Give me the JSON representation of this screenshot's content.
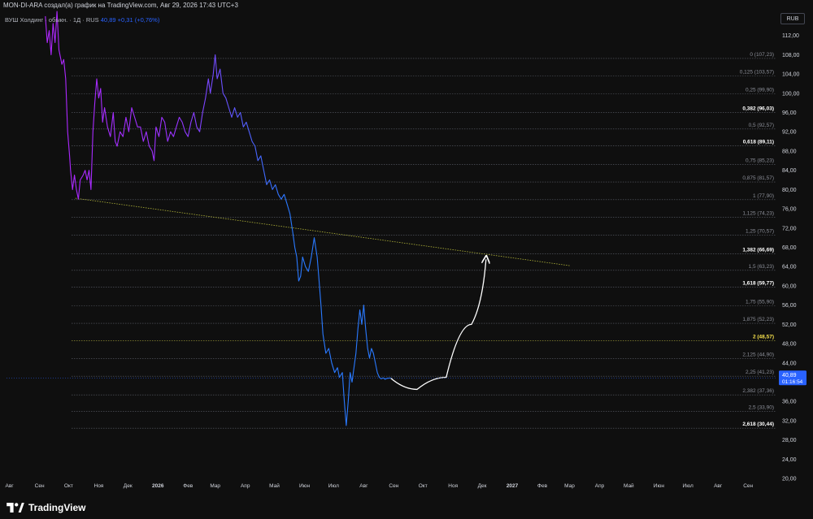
{
  "header": {
    "attribution": "MON-DI-ARA создал(а) график на TradingView.com, Авг 29, 2026 17:43 UTC+3"
  },
  "legend": {
    "symbol": "ВУШ Холдинг · обыкн. · 1Д · RUS",
    "last": "40,89",
    "change": "+0,31 (+0,76%)"
  },
  "currency_button": "RUB",
  "last_price_tag": {
    "price": "40,89",
    "countdown": "01:16:54"
  },
  "brand": {
    "name": "TradingView",
    "logo_icon": "tradingview-logo-icon"
  },
  "chart_data": {
    "type": "line",
    "y_axis": {
      "ticks": [
        20,
        24,
        28,
        32,
        36,
        40,
        44,
        48,
        52,
        56,
        60,
        64,
        68,
        72,
        76,
        80,
        84,
        88,
        92,
        96,
        100,
        104,
        108,
        112
      ],
      "labels": [
        "20,00",
        "24,00",
        "28,00",
        "32,00",
        "36,00",
        "40,00",
        "44,00",
        "48,00",
        "52,00",
        "56,00",
        "60,00",
        "64,00",
        "68,00",
        "72,00",
        "76,00",
        "80,00",
        "84,00",
        "88,00",
        "92,00",
        "96,00",
        "100,00",
        "104,00",
        "108,00",
        "112,00"
      ],
      "ylim": [
        18.5,
        117
      ]
    },
    "x_axis": {
      "start": "2025-07-29",
      "end": "2027-10-01",
      "ticks": [
        {
          "label": "Авг",
          "date": "2025-08-01"
        },
        {
          "label": "Сен",
          "date": "2025-09-01"
        },
        {
          "label": "Окт",
          "date": "2025-10-01"
        },
        {
          "label": "Ноя",
          "date": "2025-11-01"
        },
        {
          "label": "Дек",
          "date": "2025-12-01"
        },
        {
          "label": "2026",
          "date": "2026-01-01",
          "bold": true
        },
        {
          "label": "Фев",
          "date": "2026-02-01"
        },
        {
          "label": "Мар",
          "date": "2026-03-01"
        },
        {
          "label": "Апр",
          "date": "2026-04-01"
        },
        {
          "label": "Май",
          "date": "2026-05-01"
        },
        {
          "label": "Июн",
          "date": "2026-06-01"
        },
        {
          "label": "Июл",
          "date": "2026-07-01"
        },
        {
          "label": "Авг",
          "date": "2026-08-01"
        },
        {
          "label": "Сен",
          "date": "2026-09-01"
        },
        {
          "label": "Окт",
          "date": "2026-10-01"
        },
        {
          "label": "Ноя",
          "date": "2026-11-01"
        },
        {
          "label": "Дек",
          "date": "2026-12-01"
        },
        {
          "label": "2027",
          "date": "2027-01-01",
          "bold": true
        },
        {
          "label": "Фев",
          "date": "2027-02-01"
        },
        {
          "label": "Мар",
          "date": "2027-03-01"
        },
        {
          "label": "Апр",
          "date": "2027-04-01"
        },
        {
          "label": "Май",
          "date": "2027-05-01"
        },
        {
          "label": "Июн",
          "date": "2027-06-01"
        },
        {
          "label": "Июл",
          "date": "2027-07-01"
        },
        {
          "label": "Авг",
          "date": "2027-08-01"
        },
        {
          "label": "Сен",
          "date": "2027-09-01"
        }
      ]
    },
    "series": [
      {
        "color_start": "#b026ff",
        "color_end": "#2979ff",
        "points": [
          [
            "2025-09-07",
            116
          ],
          [
            "2025-09-09",
            110.5
          ],
          [
            "2025-09-11",
            113
          ],
          [
            "2025-09-13",
            108
          ],
          [
            "2025-09-15",
            114.5
          ],
          [
            "2025-09-17",
            110.5
          ],
          [
            "2025-09-19",
            117
          ],
          [
            "2025-09-21",
            109
          ],
          [
            "2025-09-24",
            106
          ],
          [
            "2025-09-26",
            107
          ],
          [
            "2025-09-28",
            103
          ],
          [
            "2025-09-30",
            92
          ],
          [
            "2025-10-02",
            87
          ],
          [
            "2025-10-03",
            84
          ],
          [
            "2025-10-05",
            80
          ],
          [
            "2025-10-07",
            83
          ],
          [
            "2025-10-09",
            80
          ],
          [
            "2025-10-11",
            78
          ],
          [
            "2025-10-13",
            82
          ],
          [
            "2025-10-16",
            83
          ],
          [
            "2025-10-18",
            84
          ],
          [
            "2025-10-20",
            82
          ],
          [
            "2025-10-22",
            84
          ],
          [
            "2025-10-24",
            80
          ],
          [
            "2025-10-26",
            92
          ],
          [
            "2025-10-28",
            98
          ],
          [
            "2025-10-30",
            103
          ],
          [
            "2025-11-01",
            99
          ],
          [
            "2025-11-03",
            101
          ],
          [
            "2025-11-05",
            94
          ],
          [
            "2025-11-07",
            97
          ],
          [
            "2025-11-10",
            93
          ],
          [
            "2025-11-13",
            91
          ],
          [
            "2025-11-16",
            96
          ],
          [
            "2025-11-18",
            90
          ],
          [
            "2025-11-20",
            89
          ],
          [
            "2025-11-23",
            92
          ],
          [
            "2025-11-26",
            91
          ],
          [
            "2025-11-29",
            95
          ],
          [
            "2025-12-02",
            92
          ],
          [
            "2025-12-05",
            97
          ],
          [
            "2025-12-08",
            95
          ],
          [
            "2025-12-11",
            93
          ],
          [
            "2025-12-14",
            93
          ],
          [
            "2025-12-17",
            90
          ],
          [
            "2025-12-20",
            92
          ],
          [
            "2025-12-23",
            89
          ],
          [
            "2025-12-26",
            88
          ],
          [
            "2025-12-28",
            86
          ],
          [
            "2025-12-30",
            93
          ],
          [
            "2026-01-02",
            91
          ],
          [
            "2026-01-05",
            95
          ],
          [
            "2026-01-08",
            94
          ],
          [
            "2026-01-11",
            90
          ],
          [
            "2026-01-14",
            92
          ],
          [
            "2026-01-17",
            91
          ],
          [
            "2026-01-20",
            93
          ],
          [
            "2026-01-23",
            95
          ],
          [
            "2026-01-26",
            94
          ],
          [
            "2026-01-29",
            92
          ],
          [
            "2026-02-01",
            91
          ],
          [
            "2026-02-04",
            94
          ],
          [
            "2026-02-07",
            96
          ],
          [
            "2026-02-10",
            93
          ],
          [
            "2026-02-13",
            92
          ],
          [
            "2026-02-16",
            96
          ],
          [
            "2026-02-19",
            99
          ],
          [
            "2026-02-22",
            103
          ],
          [
            "2026-02-24",
            100
          ],
          [
            "2026-02-27",
            104
          ],
          [
            "2026-03-01",
            108
          ],
          [
            "2026-03-03",
            103
          ],
          [
            "2026-03-06",
            105
          ],
          [
            "2026-03-09",
            100
          ],
          [
            "2026-03-12",
            99
          ],
          [
            "2026-03-15",
            97
          ],
          [
            "2026-03-18",
            95
          ],
          [
            "2026-03-21",
            97
          ],
          [
            "2026-03-24",
            95
          ],
          [
            "2026-03-27",
            96
          ],
          [
            "2026-03-30",
            93
          ],
          [
            "2026-04-02",
            94
          ],
          [
            "2026-04-05",
            92
          ],
          [
            "2026-04-08",
            90
          ],
          [
            "2026-04-11",
            89
          ],
          [
            "2026-04-14",
            86
          ],
          [
            "2026-04-17",
            87
          ],
          [
            "2026-04-20",
            84
          ],
          [
            "2026-04-23",
            81
          ],
          [
            "2026-04-26",
            82
          ],
          [
            "2026-04-29",
            80
          ],
          [
            "2026-05-02",
            81
          ],
          [
            "2026-05-05",
            79
          ],
          [
            "2026-05-08",
            78
          ],
          [
            "2026-05-11",
            79
          ],
          [
            "2026-05-14",
            77
          ],
          [
            "2026-05-17",
            75
          ],
          [
            "2026-05-20",
            71
          ],
          [
            "2026-05-22",
            68
          ],
          [
            "2026-05-24",
            66
          ],
          [
            "2026-05-26",
            61
          ],
          [
            "2026-05-28",
            62
          ],
          [
            "2026-05-30",
            66
          ],
          [
            "2026-06-02",
            64
          ],
          [
            "2026-06-05",
            63
          ],
          [
            "2026-06-08",
            66
          ],
          [
            "2026-06-11",
            70
          ],
          [
            "2026-06-14",
            66
          ],
          [
            "2026-06-16",
            61
          ],
          [
            "2026-06-18",
            56
          ],
          [
            "2026-06-20",
            50
          ],
          [
            "2026-06-23",
            46
          ],
          [
            "2026-06-26",
            47
          ],
          [
            "2026-06-29",
            44
          ],
          [
            "2026-07-02",
            42
          ],
          [
            "2026-07-05",
            43
          ],
          [
            "2026-07-07",
            41
          ],
          [
            "2026-07-10",
            42
          ],
          [
            "2026-07-12",
            36
          ],
          [
            "2026-07-14",
            31
          ],
          [
            "2026-07-16",
            36
          ],
          [
            "2026-07-18",
            42
          ],
          [
            "2026-07-20",
            40
          ],
          [
            "2026-07-22",
            43
          ],
          [
            "2026-07-24",
            46
          ],
          [
            "2026-07-26",
            51
          ],
          [
            "2026-07-28",
            55
          ],
          [
            "2026-07-30",
            52
          ],
          [
            "2026-08-01",
            56
          ],
          [
            "2026-08-03",
            51
          ],
          [
            "2026-08-05",
            47
          ],
          [
            "2026-08-07",
            45
          ],
          [
            "2026-08-09",
            47
          ],
          [
            "2026-08-11",
            46
          ],
          [
            "2026-08-13",
            44
          ],
          [
            "2026-08-15",
            42
          ],
          [
            "2026-08-17",
            41
          ],
          [
            "2026-08-19",
            40.7
          ],
          [
            "2026-08-21",
            40.9
          ],
          [
            "2026-08-23",
            40.6
          ],
          [
            "2026-08-25",
            40.8
          ],
          [
            "2026-08-29",
            40.89
          ]
        ]
      }
    ],
    "fibonacci_levels": [
      {
        "ratio": "0",
        "price": "107,23",
        "value": 107.23,
        "label": "0 (107,23)",
        "emphasis": false
      },
      {
        "ratio": "0,125",
        "price": "103,57",
        "value": 103.57,
        "label": "0,125 (103,57)",
        "emphasis": false
      },
      {
        "ratio": "0,25",
        "price": "99,90",
        "value": 99.9,
        "label": "0,25 (99,90)",
        "emphasis": false
      },
      {
        "ratio": "0,382",
        "price": "96,03",
        "value": 96.03,
        "label": "0,382 (96,03)",
        "emphasis": true
      },
      {
        "ratio": "0,5",
        "price": "92,57",
        "value": 92.57,
        "label": "0,5 (92,57)",
        "emphasis": false
      },
      {
        "ratio": "0,618",
        "price": "89,11",
        "value": 89.11,
        "label": "0,618 (89,11)",
        "emphasis": true
      },
      {
        "ratio": "0,75",
        "price": "85,23",
        "value": 85.23,
        "label": "0,75 (85,23)",
        "emphasis": false
      },
      {
        "ratio": "0,875",
        "price": "81,57",
        "value": 81.57,
        "label": "0,875 (81,57)",
        "emphasis": false
      },
      {
        "ratio": "1",
        "price": "77,90",
        "value": 77.9,
        "label": "1 (77,90)",
        "emphasis": false
      },
      {
        "ratio": "1,125",
        "price": "74,23",
        "value": 74.23,
        "label": "1,125 (74,23)",
        "emphasis": false
      },
      {
        "ratio": "1,25",
        "price": "70,57",
        "value": 70.57,
        "label": "1,25 (70,57)",
        "emphasis": false
      },
      {
        "ratio": "1,382",
        "price": "66,69",
        "value": 66.69,
        "label": "1,382 (66,69)",
        "emphasis": true
      },
      {
        "ratio": "1,5",
        "price": "63,23",
        "value": 63.23,
        "label": "1,5 (63,23)",
        "emphasis": false
      },
      {
        "ratio": "1,618",
        "price": "59,77",
        "value": 59.77,
        "label": "1,618 (59,77)",
        "emphasis": true
      },
      {
        "ratio": "1,75",
        "price": "55,90",
        "value": 55.9,
        "label": "1,75 (55,90)",
        "emphasis": false
      },
      {
        "ratio": "1,875",
        "price": "52,23",
        "value": 52.23,
        "label": "1,875 (52,23)",
        "emphasis": false
      },
      {
        "ratio": "2",
        "price": "48,57",
        "value": 48.57,
        "label": "2 (48,57)",
        "emphasis": "yellow"
      },
      {
        "ratio": "2,125",
        "price": "44,90",
        "value": 44.9,
        "label": "2,125 (44,90)",
        "emphasis": false
      },
      {
        "ratio": "2,25",
        "price": "41,23",
        "value": 41.23,
        "label": "2,25 (41,23)",
        "emphasis": false
      },
      {
        "ratio": "2,382",
        "price": "37,36",
        "value": 37.36,
        "label": "2,382 (37,36)",
        "emphasis": false
      },
      {
        "ratio": "2,5",
        "price": "33,90",
        "value": 33.9,
        "label": "2,5 (33,90)",
        "emphasis": false
      },
      {
        "ratio": "2,618",
        "price": "30,44",
        "value": 30.44,
        "label": "2,618 (30,44)",
        "emphasis": true
      }
    ],
    "trendline": {
      "color": "#b5b83a",
      "from": [
        "2025-10-08",
        78.2
      ],
      "to": [
        "2027-03-01",
        64.2
      ]
    },
    "projection_arrow": {
      "color": "#ffffff",
      "points": [
        [
          "2026-08-29",
          40.8
        ],
        [
          "2026-09-25",
          38.5
        ],
        [
          "2026-10-25",
          41
        ],
        [
          "2026-11-20",
          52
        ],
        [
          "2026-12-05",
          65.5
        ]
      ]
    },
    "last_price": {
      "value": 40.89,
      "color": "#2962ff"
    },
    "colors": {
      "background": "#0f0f0f",
      "fib_line": "#787b86",
      "fib_highlight": "#f7e14c",
      "text": "#b2b5be",
      "axis_text": "#d1d4dc"
    },
    "grid": false,
    "legend_position": "top-left"
  }
}
